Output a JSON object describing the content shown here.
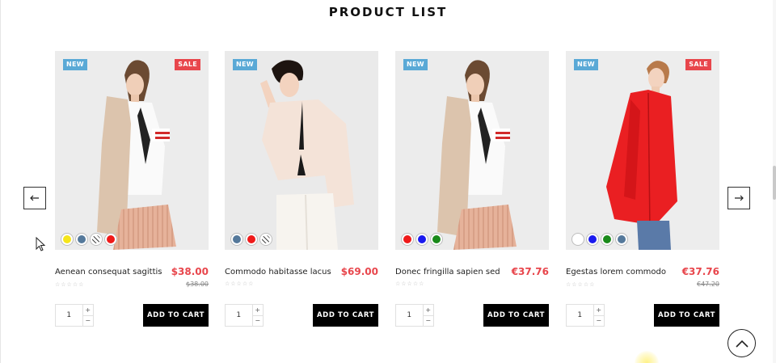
{
  "section": {
    "title": "PRODUCT LIST"
  },
  "carousel": {
    "prev_icon": "arrow-left-icon",
    "next_icon": "arrow-right-icon"
  },
  "back_to_top_icon": "chevron-up-icon",
  "badges": {
    "new": "NEW",
    "sale": "SALE"
  },
  "add_to_cart_label": "ADD TO CART",
  "products": [
    {
      "name": "Aenean consequat sagittis",
      "price": "$38.00",
      "old_price": "$38.00",
      "rating": "☆☆☆☆☆",
      "quantity": "1",
      "new": "NEW",
      "sale": "SALE",
      "image": "woman-beige-coat-pleated-skirt",
      "swatches": [
        "#f5e51b",
        "#55799b",
        "#ffffff",
        "#ef1a1a"
      ]
    },
    {
      "name": "Commodo habitasse lacus",
      "price": "$69.00",
      "old_price": "",
      "rating": "☆☆☆☆☆",
      "quantity": "1",
      "new": "NEW",
      "sale": "",
      "image": "woman-cream-blouse-tie",
      "swatches": [
        "#55799b",
        "#ef1a1a",
        "#ffffff"
      ]
    },
    {
      "name": "Donec fringilla sapien sed",
      "price": "€37.76",
      "old_price": "",
      "rating": "☆☆☆☆☆",
      "quantity": "1",
      "new": "NEW",
      "sale": "",
      "image": "woman-beige-coat-pleated-skirt",
      "swatches": [
        "#ef1a1a",
        "#1a1aef",
        "#1a8a1a"
      ]
    },
    {
      "name": "Egestas lorem commodo",
      "price": "€37.76",
      "old_price": "€47.20",
      "rating": "☆☆☆☆☆",
      "quantity": "1",
      "new": "NEW",
      "sale": "SALE",
      "image": "woman-red-coat",
      "swatches": [
        "#ffffff",
        "#1a1aef",
        "#1a8a1a",
        "#55799b"
      ]
    }
  ]
}
